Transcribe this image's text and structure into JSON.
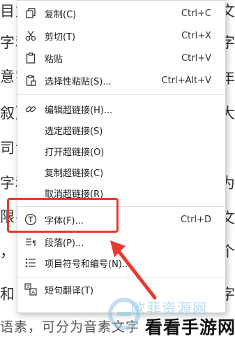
{
  "background_text": {
    "left_lines": [
      "目益",
      "字和",
      "意字",
      "叙》",
      "司记",
      "字和",
      "限名",
      "，",
      "和",
      "语素，可分为音素文字"
    ],
    "right_lines": [
      "文",
      "字",
      "年",
      "大",
      "。",
      "为",
      "文",
      "个",
      "字"
    ]
  },
  "menu": {
    "items": [
      {
        "label": "复制(C)",
        "shortcut": "Ctrl+C",
        "icon": "copy-icon"
      },
      {
        "label": "剪切(T)",
        "shortcut": "Ctrl+X",
        "icon": "scissors-icon"
      },
      {
        "label": "粘贴",
        "shortcut": "Ctrl+V",
        "icon": "paste-icon"
      },
      {
        "label": "选择性粘贴(S)...",
        "shortcut": "Ctrl+Alt+V",
        "icon": "paste-special-icon"
      },
      {
        "label": "编辑超链接(H)...",
        "shortcut": "",
        "icon": "link-icon"
      },
      {
        "label": "选定超链接(S)",
        "shortcut": "",
        "icon": ""
      },
      {
        "label": "打开超链接(O)",
        "shortcut": "",
        "icon": ""
      },
      {
        "label": "复制超链接(C)",
        "shortcut": "",
        "icon": ""
      },
      {
        "label": "取消超链接(R)",
        "shortcut": "",
        "icon": ""
      },
      {
        "label": "字体(F)...",
        "shortcut": "Ctrl+D",
        "icon": "font-icon"
      },
      {
        "label": "段落(P)...",
        "shortcut": "",
        "icon": "paragraph-icon"
      },
      {
        "label": "项目符号和编号(N)...",
        "shortcut": "",
        "icon": "list-bullets-icon"
      },
      {
        "label": "短句翻译(T)",
        "shortcut": "",
        "icon": "translate-icon"
      }
    ]
  },
  "watermark": {
    "line1": "欧菲资源网",
    "line2": "看看手游网"
  },
  "colors": {
    "highlight": "#e53a2e",
    "watermark_blue": "#8fc6e6"
  }
}
